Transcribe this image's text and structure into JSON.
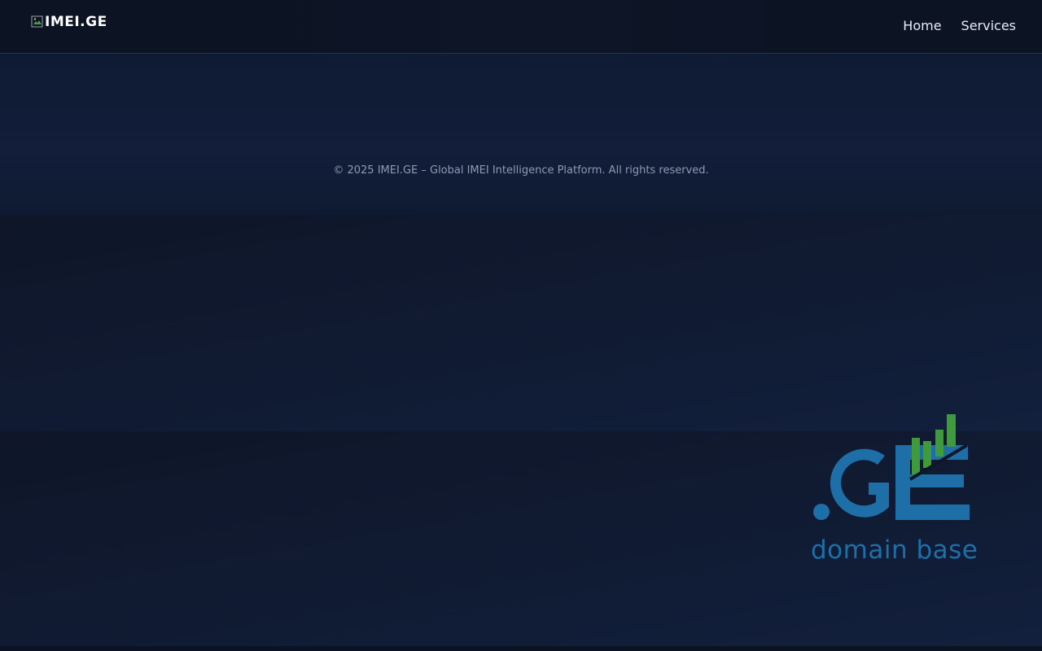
{
  "header": {
    "logo_text": "IMEI.GE",
    "nav": [
      {
        "label": "Home"
      },
      {
        "label": "Services"
      }
    ]
  },
  "footer": {
    "copyright": "© 2025 IMEI.GE – Global IMEI Intelligence Platform. All rights reserved."
  },
  "badge": {
    "wordmark": ".GE",
    "tagline": "domain base"
  },
  "colors": {
    "header_bg": "#0c1322",
    "page_bg": "#0f1728",
    "nav_text": "#e6ebf5",
    "footer_text": "#8f9ab0",
    "brand_blue": "#1e6fa8",
    "brand_green": "#3f9a3c"
  },
  "icons": {
    "logo_image": "broken-image-icon"
  }
}
